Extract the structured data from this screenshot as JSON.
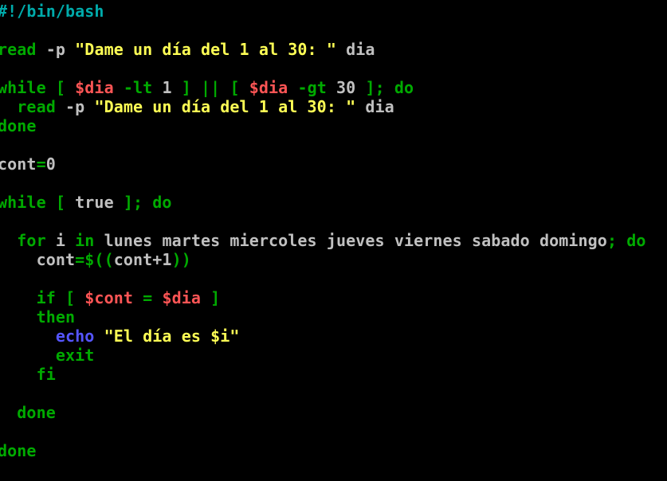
{
  "editor": {
    "background": "#000000",
    "palette": {
      "comment": "#00aaaa",
      "keyword": "#00aa00",
      "string": "#ffff55",
      "variable": "#ff5555",
      "plain": "#c0c0c0",
      "builtin": "#5555ff"
    },
    "lines": [
      [
        {
          "t": "#!/bin/bash",
          "k": "comment"
        }
      ],
      [],
      [
        {
          "t": "read",
          "k": "keyword"
        },
        {
          "t": " -p ",
          "k": "plain"
        },
        {
          "t": "\"Dame un día del 1 al 30: \"",
          "k": "string"
        },
        {
          "t": " dia",
          "k": "plain"
        }
      ],
      [],
      [
        {
          "t": "while [ ",
          "k": "keyword"
        },
        {
          "t": "$dia",
          "k": "variable"
        },
        {
          "t": " -lt ",
          "k": "keyword"
        },
        {
          "t": "1",
          "k": "plain"
        },
        {
          "t": " ] || [ ",
          "k": "keyword"
        },
        {
          "t": "$dia",
          "k": "variable"
        },
        {
          "t": " -gt ",
          "k": "keyword"
        },
        {
          "t": "30",
          "k": "plain"
        },
        {
          "t": " ]; do",
          "k": "keyword"
        }
      ],
      [
        {
          "t": "  read",
          "k": "keyword"
        },
        {
          "t": " -p ",
          "k": "plain"
        },
        {
          "t": "\"Dame un día del 1 al 30: \"",
          "k": "string"
        },
        {
          "t": " dia",
          "k": "plain"
        }
      ],
      [
        {
          "t": "done",
          "k": "keyword"
        }
      ],
      [],
      [
        {
          "t": "cont",
          "k": "plain"
        },
        {
          "t": "=",
          "k": "keyword"
        },
        {
          "t": "0",
          "k": "plain"
        }
      ],
      [],
      [
        {
          "t": "while [ ",
          "k": "keyword"
        },
        {
          "t": "true",
          "k": "plain"
        },
        {
          "t": " ]; do",
          "k": "keyword"
        }
      ],
      [],
      [
        {
          "t": "  for",
          "k": "keyword"
        },
        {
          "t": " i ",
          "k": "plain"
        },
        {
          "t": "in",
          "k": "keyword"
        },
        {
          "t": " lunes martes miercoles jueves viernes sabado domingo",
          "k": "plain"
        },
        {
          "t": "; do",
          "k": "keyword"
        }
      ],
      [
        {
          "t": "    cont",
          "k": "plain"
        },
        {
          "t": "=$((",
          "k": "keyword"
        },
        {
          "t": "cont+1",
          "k": "plain"
        },
        {
          "t": "))",
          "k": "keyword"
        }
      ],
      [],
      [
        {
          "t": "    if [ ",
          "k": "keyword"
        },
        {
          "t": "$cont",
          "k": "variable"
        },
        {
          "t": " = ",
          "k": "keyword"
        },
        {
          "t": "$dia",
          "k": "variable"
        },
        {
          "t": " ]",
          "k": "keyword"
        }
      ],
      [
        {
          "t": "    then",
          "k": "keyword"
        }
      ],
      [
        {
          "t": "      echo",
          "k": "builtin"
        },
        {
          "t": " \"El día es $i\"",
          "k": "string"
        }
      ],
      [
        {
          "t": "      exit",
          "k": "keyword"
        }
      ],
      [
        {
          "t": "    fi",
          "k": "keyword"
        }
      ],
      [],
      [
        {
          "t": "  done",
          "k": "keyword"
        }
      ],
      [],
      [
        {
          "t": "done",
          "k": "keyword"
        }
      ]
    ]
  }
}
